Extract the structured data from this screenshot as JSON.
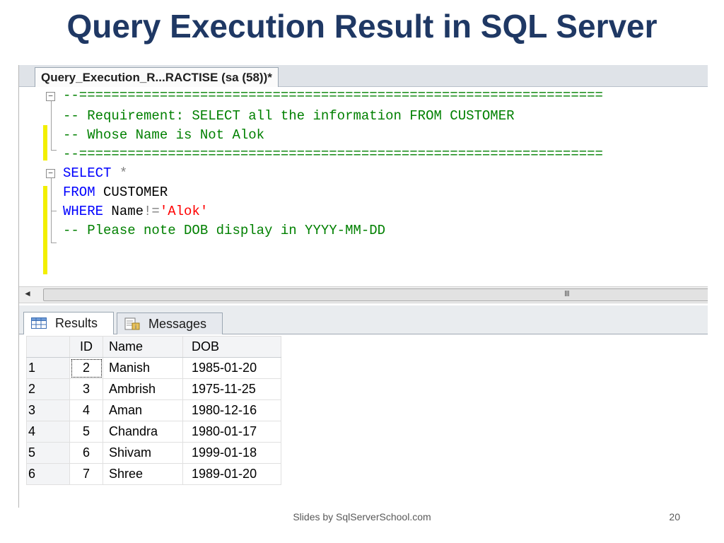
{
  "slide": {
    "title": "Query Execution Result in SQL Server",
    "footer": "Slides by SqlServerSchool.com",
    "page_number": "20"
  },
  "editor": {
    "tab_title": "Query_Execution_R...RACTISE (sa (58))*",
    "lines": {
      "l1": "--=================================================================",
      "l2": "-- Requirement: SELECT all the information FROM CUSTOMER",
      "l3": "-- Whose Name is Not Alok",
      "l4": "--=================================================================",
      "l5_kw": "SELECT",
      "l5_rest": " *",
      "l6_kw": "FROM",
      "l6_rest": " CUSTOMER",
      "l7_kw": "WHERE",
      "l7_col": " Name",
      "l7_op": "!=",
      "l7_str": "'Alok'",
      "l8": "-- Please note DOB display in YYYY-MM-DD"
    },
    "scroll_grip": "III",
    "scroll_left_arrow": "◄"
  },
  "results": {
    "tabs": {
      "results_label": "Results",
      "messages_label": "Messages"
    },
    "columns": [
      "ID",
      "Name",
      "DOB"
    ],
    "rows": [
      {
        "rownum": "1",
        "id": "2",
        "name": "Manish",
        "dob": "1985-01-20"
      },
      {
        "rownum": "2",
        "id": "3",
        "name": "Ambrish",
        "dob": "1975-11-25"
      },
      {
        "rownum": "3",
        "id": "4",
        "name": "Aman",
        "dob": "1980-12-16"
      },
      {
        "rownum": "4",
        "id": "5",
        "name": "Chandra",
        "dob": "1980-01-17"
      },
      {
        "rownum": "5",
        "id": "6",
        "name": "Shivam",
        "dob": "1999-01-18"
      },
      {
        "rownum": "6",
        "id": "7",
        "name": "Shree",
        "dob": "1989-01-20"
      }
    ]
  },
  "colors": {
    "title": "#1f3864",
    "comment": "#008000",
    "keyword": "#0000ff",
    "string": "#ff0000",
    "change_marker": "#f2ef00"
  }
}
